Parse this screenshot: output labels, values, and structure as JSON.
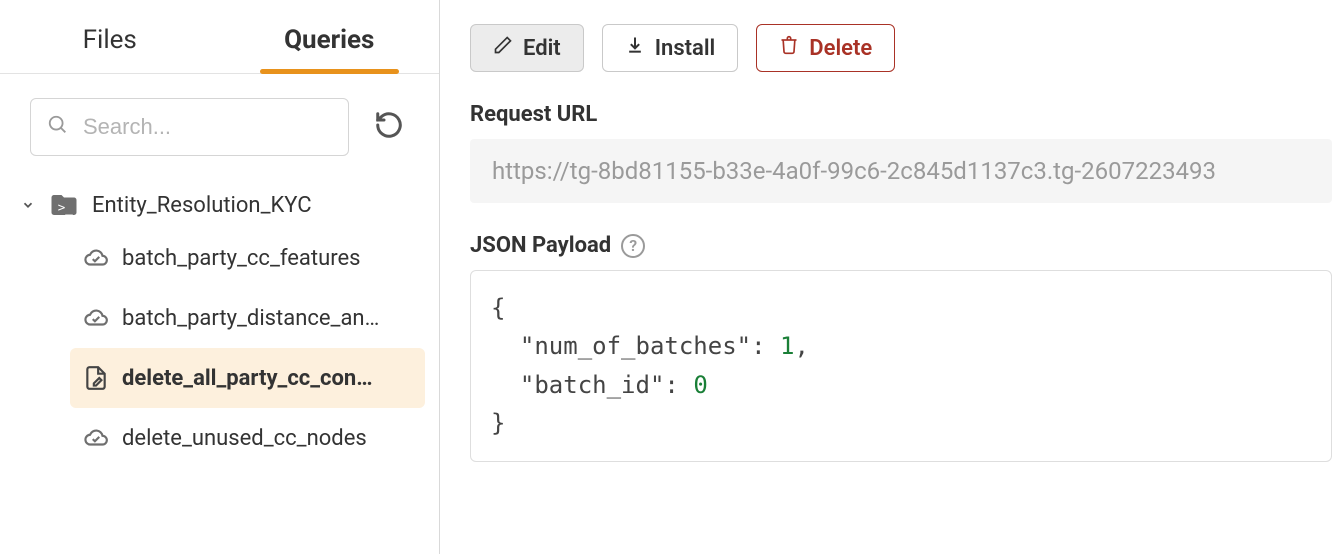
{
  "tabs": {
    "files": "Files",
    "queries": "Queries",
    "active": "queries"
  },
  "search": {
    "placeholder": "Search..."
  },
  "tree": {
    "folder": {
      "name": "Entity_Resolution_KYC",
      "expanded": true,
      "items": [
        {
          "label": "batch_party_cc_features",
          "icon": "cloud",
          "selected": false
        },
        {
          "label": "batch_party_distance_an…",
          "icon": "cloud",
          "selected": false
        },
        {
          "label": "delete_all_party_cc_con…",
          "icon": "file-edit",
          "selected": true
        },
        {
          "label": "delete_unused_cc_nodes",
          "icon": "cloud",
          "selected": false
        }
      ]
    }
  },
  "toolbar": {
    "edit": "Edit",
    "install": "Install",
    "delete": "Delete"
  },
  "request_url": {
    "label": "Request URL",
    "value": "https://tg-8bd81155-b33e-4a0f-99c6-2c845d1137c3.tg-2607223493"
  },
  "json_payload": {
    "label": "JSON Payload",
    "keys": {
      "k1": "\"num_of_batches\"",
      "k2": "\"batch_id\""
    },
    "vals": {
      "v1": "1",
      "v2": "0"
    },
    "braces": {
      "open": "{",
      "close": "}"
    },
    "colon": ": ",
    "comma": ","
  }
}
